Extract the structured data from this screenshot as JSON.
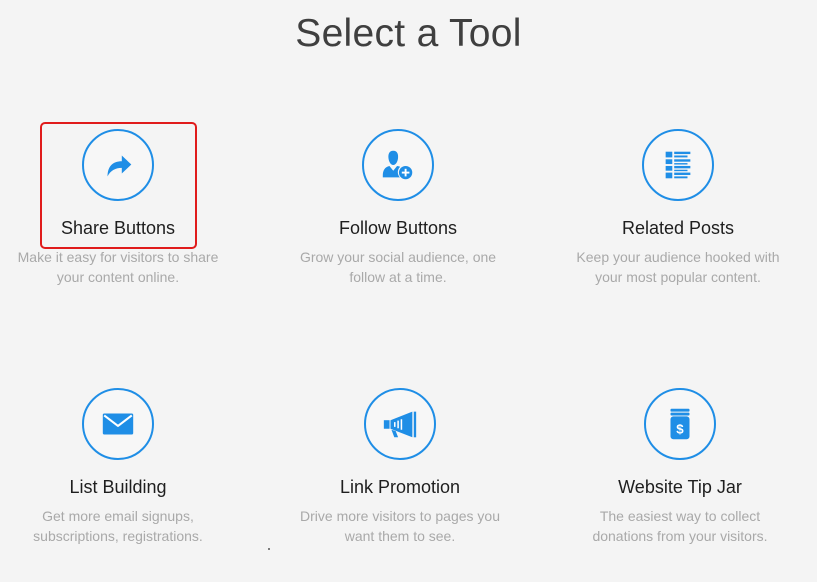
{
  "page": {
    "title": "Select a Tool"
  },
  "tools": [
    {
      "title": "Share Buttons",
      "description": "Make it easy for visitors to share your content online.",
      "icon": "share-arrow-icon"
    },
    {
      "title": "Follow Buttons",
      "description": "Grow your social audience, one follow at a time.",
      "icon": "add-user-icon"
    },
    {
      "title": "Related Posts",
      "description": "Keep your audience hooked with your most popular content.",
      "icon": "list-icon"
    },
    {
      "title": "List Building",
      "description": "Get more email signups, subscriptions, registrations.",
      "icon": "envelope-icon"
    },
    {
      "title": "Link Promotion",
      "description": "Drive more visitors to pages you want them to see.",
      "icon": "megaphone-icon"
    },
    {
      "title": "Website Tip Jar",
      "description": "The easiest way to collect donations from your visitors.",
      "icon": "tip-jar-icon"
    }
  ],
  "colors": {
    "accent": "#1f8ee6",
    "highlight": "#e01b1b",
    "background": "#f4f4f4",
    "title_text": "#1e1e1e",
    "description_text": "#a9a9a9"
  }
}
